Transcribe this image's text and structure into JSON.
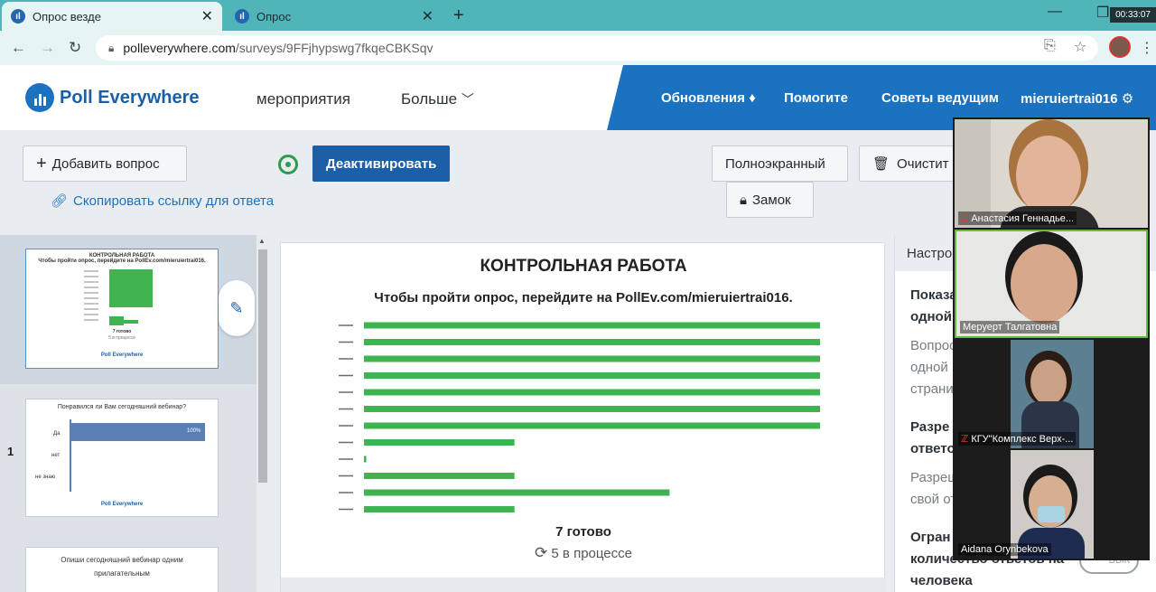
{
  "browser": {
    "tabs": [
      {
        "title": "Опрос везде",
        "active": true
      },
      {
        "title": "Опрос",
        "active": false
      }
    ],
    "timer": "00:33:07",
    "url_host": "polleverywhere.com",
    "url_path": "/surveys/9FFjhypswg7fkqeCBKSqv"
  },
  "header": {
    "logo_text": "Poll Everywhere",
    "nav_events": "мероприятия",
    "nav_more": "Больше",
    "updates": "Обновления",
    "help": "Помогите",
    "tips": "Советы ведущим",
    "username": "mieruiertrai016"
  },
  "toolbar": {
    "add_question": "Добавить вопрос",
    "deactivate": "Деактивировать",
    "copy_link": "Скопировать ссылку для ответа",
    "fullscreen": "Полноэкранный",
    "clear": "Очистит",
    "lock": "Замок"
  },
  "thumbnails": [
    {
      "title": "КОНТРОЛЬНАЯ РАБОТА",
      "subtitle": "Чтобы пройти опрос, перейдите на PollEv.com/mieruiertrai016.",
      "ready": "7 готово",
      "progress": "5 в процессе",
      "footer": "Poll Everywhere"
    },
    {
      "number": "1",
      "title": "Понравился ли Вам сегодняшний вебинар?",
      "options": [
        "Да",
        "нет",
        "не знаю"
      ],
      "percent": "100%",
      "footer": "Poll Everywhere"
    },
    {
      "title": "Опиши сегодняшний вебинар одним прилагательным"
    }
  ],
  "slide": {
    "title": "КОНТРОЛЬНАЯ РАБОТА",
    "subtitle": "Чтобы пройти опрос, перейдите на PollEv.com/mieruiertrai016.",
    "ready": "7 готово",
    "in_progress": "5 в процессе"
  },
  "chart_data": {
    "type": "bar",
    "orientation": "horizontal",
    "categories": [
      "",
      "",
      "",
      "",
      "",
      "",
      "",
      "",
      "",
      "",
      "",
      ""
    ],
    "values": [
      100,
      100,
      100,
      100,
      100,
      100,
      100,
      33,
      0.5,
      33,
      67,
      33
    ],
    "color": "#3fb34f"
  },
  "settings": {
    "header": "Настро",
    "items": [
      {
        "text": "Показа",
        "style": "bold"
      },
      {
        "text": "одной",
        "style": "bold"
      },
      {
        "text": "Вопрос",
        "style": "grey"
      },
      {
        "text": "одной",
        "style": "grey"
      },
      {
        "text": "страни",
        "style": "grey"
      },
      {
        "text": "Разре",
        "style": "bold"
      },
      {
        "text": "ответо",
        "style": "bold"
      },
      {
        "text": "Разреш",
        "style": "grey"
      },
      {
        "text": "свой от",
        "style": "grey"
      },
      {
        "text": "Огран",
        "style": "bold"
      },
      {
        "text": "количество ответов на",
        "style": "bold"
      },
      {
        "text": "человека",
        "style": "bold"
      }
    ],
    "toggle_label": "ВЫК"
  },
  "participants": [
    {
      "name": "Анастасия Геннадье...",
      "muted": true
    },
    {
      "name": "Меруерт Талгатовна",
      "muted": false
    },
    {
      "name": "КГУ\"Комплекс Верх-...",
      "muted": true
    },
    {
      "name": "Aidana Orynbekova",
      "muted": false
    }
  ],
  "colors": {
    "brand_blue": "#1b72c0",
    "primary_button": "#1b5fa8",
    "bar_green": "#3fb34f",
    "tab_teal": "#4fb5b9"
  }
}
